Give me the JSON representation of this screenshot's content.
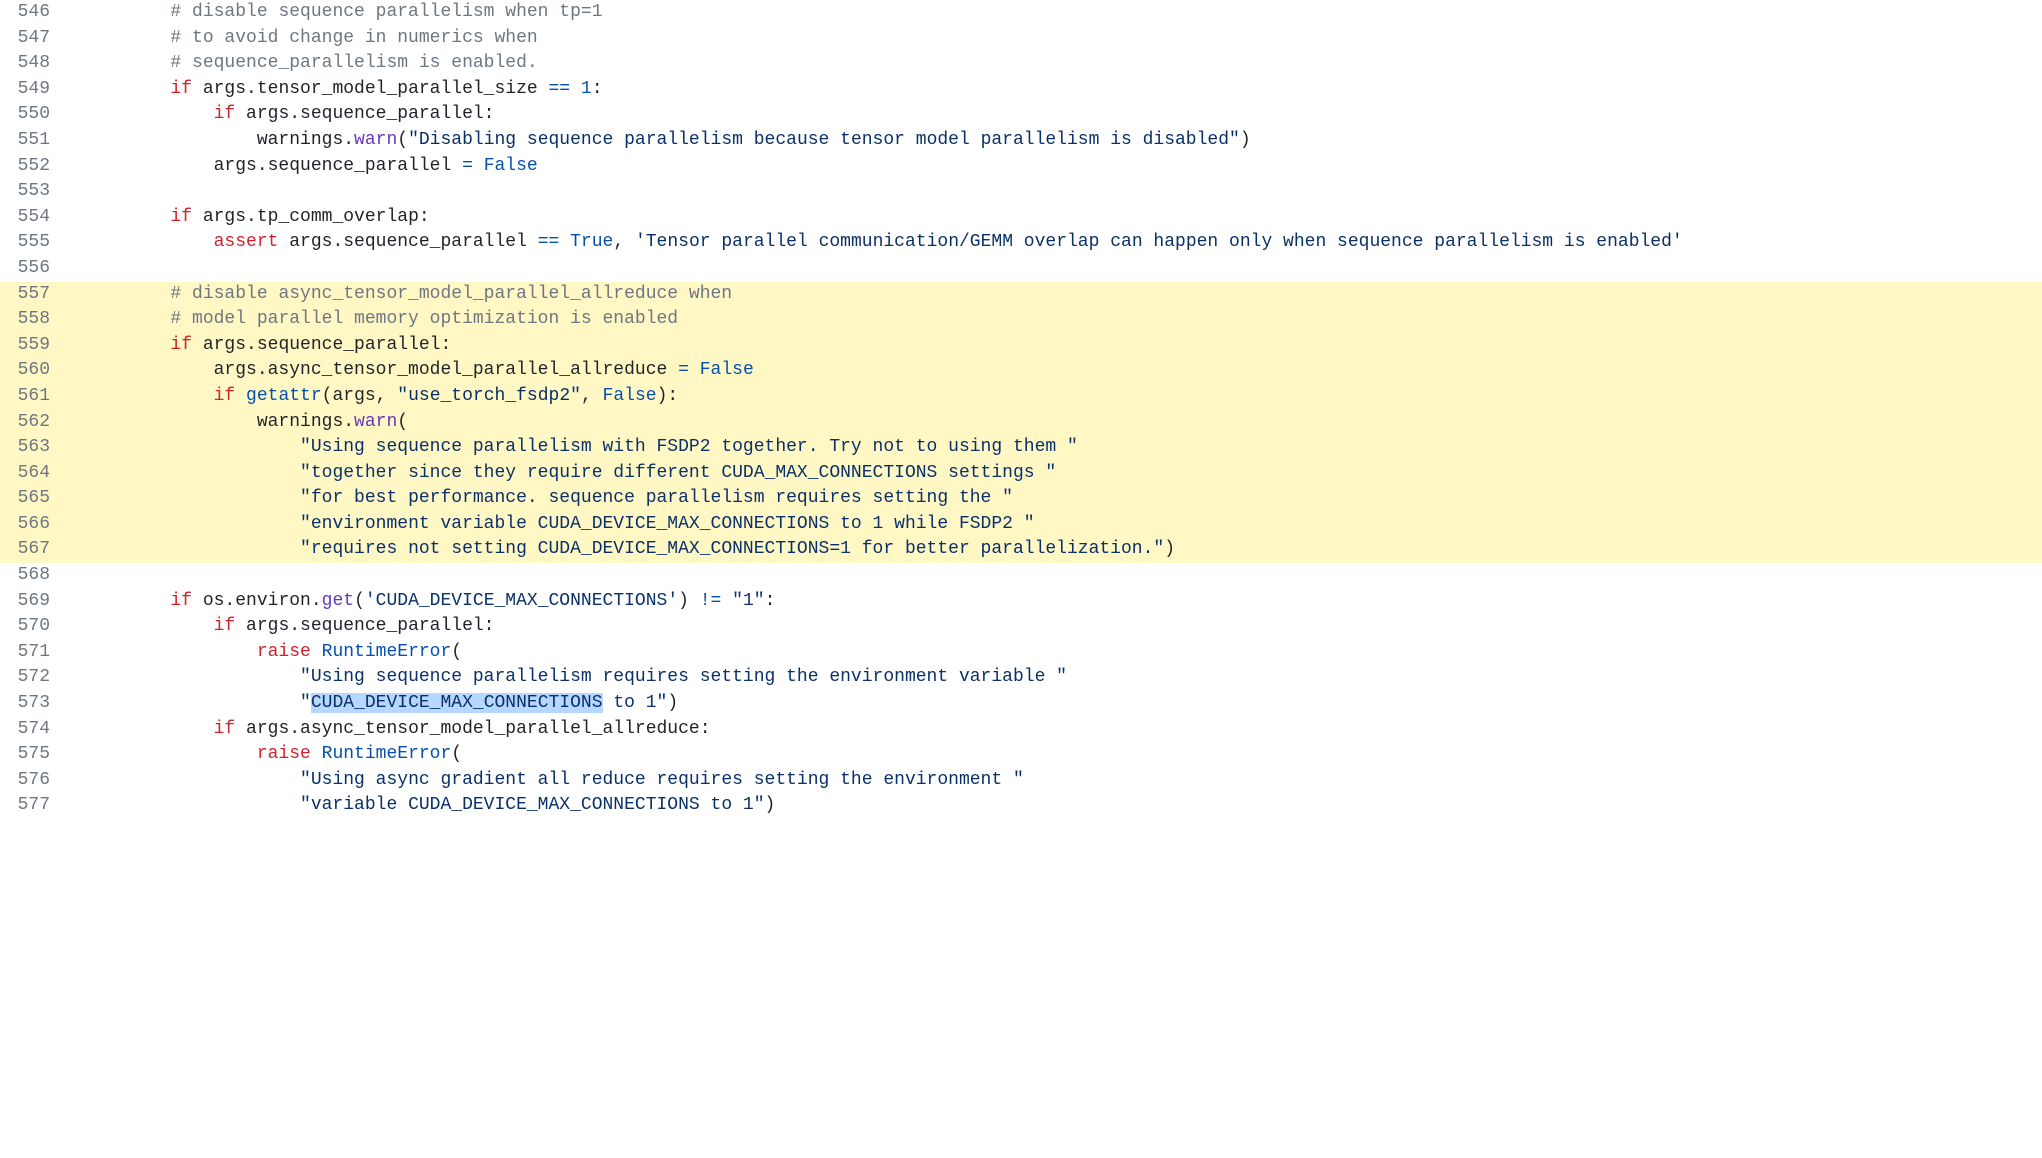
{
  "lines": [
    {
      "n": 546,
      "hl": false,
      "segs": [
        {
          "t": "        ",
          "c": ""
        },
        {
          "t": "# disable sequence parallelism when tp=1",
          "c": "c-comment"
        }
      ]
    },
    {
      "n": 547,
      "hl": false,
      "segs": [
        {
          "t": "        ",
          "c": ""
        },
        {
          "t": "# to avoid change in numerics when",
          "c": "c-comment"
        }
      ]
    },
    {
      "n": 548,
      "hl": false,
      "segs": [
        {
          "t": "        ",
          "c": ""
        },
        {
          "t": "# sequence_parallelism is enabled.",
          "c": "c-comment"
        }
      ]
    },
    {
      "n": 549,
      "hl": false,
      "segs": [
        {
          "t": "        ",
          "c": ""
        },
        {
          "t": "if",
          "c": "c-kw"
        },
        {
          "t": " args.tensor_model_parallel_size ",
          "c": ""
        },
        {
          "t": "==",
          "c": "c-op"
        },
        {
          "t": " ",
          "c": ""
        },
        {
          "t": "1",
          "c": "c-const"
        },
        {
          "t": ":",
          "c": ""
        }
      ]
    },
    {
      "n": 550,
      "hl": false,
      "segs": [
        {
          "t": "            ",
          "c": ""
        },
        {
          "t": "if",
          "c": "c-kw"
        },
        {
          "t": " args.sequence_parallel:",
          "c": ""
        }
      ]
    },
    {
      "n": 551,
      "hl": false,
      "segs": [
        {
          "t": "                warnings.",
          "c": ""
        },
        {
          "t": "warn",
          "c": "c-func"
        },
        {
          "t": "(",
          "c": ""
        },
        {
          "t": "\"Disabling sequence parallelism because tensor model parallelism is disabled\"",
          "c": "c-str"
        },
        {
          "t": ")",
          "c": ""
        }
      ]
    },
    {
      "n": 552,
      "hl": false,
      "segs": [
        {
          "t": "            args.sequence_parallel ",
          "c": ""
        },
        {
          "t": "=",
          "c": "c-op"
        },
        {
          "t": " ",
          "c": ""
        },
        {
          "t": "False",
          "c": "c-const"
        }
      ]
    },
    {
      "n": 553,
      "hl": false,
      "segs": [
        {
          "t": "",
          "c": ""
        }
      ]
    },
    {
      "n": 554,
      "hl": false,
      "segs": [
        {
          "t": "        ",
          "c": ""
        },
        {
          "t": "if",
          "c": "c-kw"
        },
        {
          "t": " args.tp_comm_overlap:",
          "c": ""
        }
      ]
    },
    {
      "n": 555,
      "hl": false,
      "segs": [
        {
          "t": "            ",
          "c": ""
        },
        {
          "t": "assert",
          "c": "c-kw"
        },
        {
          "t": " args.sequence_parallel ",
          "c": ""
        },
        {
          "t": "==",
          "c": "c-op"
        },
        {
          "t": " ",
          "c": ""
        },
        {
          "t": "True",
          "c": "c-const"
        },
        {
          "t": ", ",
          "c": ""
        },
        {
          "t": "'Tensor parallel communication/GEMM overlap can happen only when sequence parallelism is enabled'",
          "c": "c-str"
        }
      ]
    },
    {
      "n": 556,
      "hl": false,
      "segs": [
        {
          "t": "",
          "c": ""
        }
      ]
    },
    {
      "n": 557,
      "hl": true,
      "segs": [
        {
          "t": "        ",
          "c": ""
        },
        {
          "t": "# disable async_tensor_model_parallel_allreduce when",
          "c": "c-comment"
        }
      ]
    },
    {
      "n": 558,
      "hl": true,
      "segs": [
        {
          "t": "        ",
          "c": ""
        },
        {
          "t": "# model parallel memory optimization is enabled",
          "c": "c-comment"
        }
      ]
    },
    {
      "n": 559,
      "hl": true,
      "segs": [
        {
          "t": "        ",
          "c": ""
        },
        {
          "t": "if",
          "c": "c-kw"
        },
        {
          "t": " args.sequence_parallel:",
          "c": ""
        }
      ]
    },
    {
      "n": 560,
      "hl": true,
      "segs": [
        {
          "t": "            args.async_tensor_model_parallel_allreduce ",
          "c": ""
        },
        {
          "t": "=",
          "c": "c-op"
        },
        {
          "t": " ",
          "c": ""
        },
        {
          "t": "False",
          "c": "c-const"
        }
      ]
    },
    {
      "n": 561,
      "hl": true,
      "segs": [
        {
          "t": "            ",
          "c": ""
        },
        {
          "t": "if",
          "c": "c-kw"
        },
        {
          "t": " ",
          "c": ""
        },
        {
          "t": "getattr",
          "c": "c-builtin"
        },
        {
          "t": "(args, ",
          "c": ""
        },
        {
          "t": "\"use_torch_fsdp2\"",
          "c": "c-str"
        },
        {
          "t": ", ",
          "c": ""
        },
        {
          "t": "False",
          "c": "c-const"
        },
        {
          "t": "):",
          "c": ""
        }
      ]
    },
    {
      "n": 562,
      "hl": true,
      "segs": [
        {
          "t": "                warnings.",
          "c": ""
        },
        {
          "t": "warn",
          "c": "c-func"
        },
        {
          "t": "(",
          "c": ""
        }
      ]
    },
    {
      "n": 563,
      "hl": true,
      "segs": [
        {
          "t": "                    ",
          "c": ""
        },
        {
          "t": "\"Using sequence parallelism with FSDP2 together. Try not to using them \"",
          "c": "c-str"
        }
      ]
    },
    {
      "n": 564,
      "hl": true,
      "segs": [
        {
          "t": "                    ",
          "c": ""
        },
        {
          "t": "\"together since they require different CUDA_MAX_CONNECTIONS settings \"",
          "c": "c-str"
        }
      ]
    },
    {
      "n": 565,
      "hl": true,
      "segs": [
        {
          "t": "                    ",
          "c": ""
        },
        {
          "t": "\"for best performance. sequence parallelism requires setting the \"",
          "c": "c-str"
        }
      ]
    },
    {
      "n": 566,
      "hl": true,
      "segs": [
        {
          "t": "                    ",
          "c": ""
        },
        {
          "t": "\"environment variable CUDA_DEVICE_MAX_CONNECTIONS to 1 while FSDP2 \"",
          "c": "c-str"
        }
      ]
    },
    {
      "n": 567,
      "hl": true,
      "segs": [
        {
          "t": "                    ",
          "c": ""
        },
        {
          "t": "\"requires not setting CUDA_DEVICE_MAX_CONNECTIONS=1 for better parallelization.\"",
          "c": "c-str"
        },
        {
          "t": ")",
          "c": ""
        }
      ]
    },
    {
      "n": 568,
      "hl": false,
      "segs": [
        {
          "t": "",
          "c": ""
        }
      ]
    },
    {
      "n": 569,
      "hl": false,
      "segs": [
        {
          "t": "        ",
          "c": ""
        },
        {
          "t": "if",
          "c": "c-kw"
        },
        {
          "t": " os.environ.",
          "c": ""
        },
        {
          "t": "get",
          "c": "c-func"
        },
        {
          "t": "(",
          "c": ""
        },
        {
          "t": "'CUDA_DEVICE_MAX_CONNECTIONS'",
          "c": "c-str"
        },
        {
          "t": ") ",
          "c": ""
        },
        {
          "t": "!=",
          "c": "c-op"
        },
        {
          "t": " ",
          "c": ""
        },
        {
          "t": "\"1\"",
          "c": "c-str"
        },
        {
          "t": ":",
          "c": ""
        }
      ]
    },
    {
      "n": 570,
      "hl": false,
      "segs": [
        {
          "t": "            ",
          "c": ""
        },
        {
          "t": "if",
          "c": "c-kw"
        },
        {
          "t": " args.sequence_parallel:",
          "c": ""
        }
      ]
    },
    {
      "n": 571,
      "hl": false,
      "segs": [
        {
          "t": "                ",
          "c": ""
        },
        {
          "t": "raise",
          "c": "c-kw"
        },
        {
          "t": " ",
          "c": ""
        },
        {
          "t": "RuntimeError",
          "c": "c-builtin"
        },
        {
          "t": "(",
          "c": ""
        }
      ]
    },
    {
      "n": 572,
      "hl": false,
      "segs": [
        {
          "t": "                    ",
          "c": ""
        },
        {
          "t": "\"Using sequence parallelism requires setting the environment variable \"",
          "c": "c-str"
        }
      ]
    },
    {
      "n": 573,
      "hl": false,
      "segs": [
        {
          "t": "                    ",
          "c": ""
        },
        {
          "t": "\"",
          "c": "c-str"
        },
        {
          "t": "CUDA_DEVICE_MAX_CONNECTIONS",
          "c": "c-str sel"
        },
        {
          "t": " to 1\"",
          "c": "c-str"
        },
        {
          "t": ")",
          "c": ""
        }
      ]
    },
    {
      "n": 574,
      "hl": false,
      "segs": [
        {
          "t": "            ",
          "c": ""
        },
        {
          "t": "if",
          "c": "c-kw"
        },
        {
          "t": " args.async_tensor_model_parallel_allreduce:",
          "c": ""
        }
      ]
    },
    {
      "n": 575,
      "hl": false,
      "segs": [
        {
          "t": "                ",
          "c": ""
        },
        {
          "t": "raise",
          "c": "c-kw"
        },
        {
          "t": " ",
          "c": ""
        },
        {
          "t": "RuntimeError",
          "c": "c-builtin"
        },
        {
          "t": "(",
          "c": ""
        }
      ]
    },
    {
      "n": 576,
      "hl": false,
      "segs": [
        {
          "t": "                    ",
          "c": ""
        },
        {
          "t": "\"Using async gradient all reduce requires setting the environment \"",
          "c": "c-str"
        }
      ]
    },
    {
      "n": 577,
      "hl": false,
      "segs": [
        {
          "t": "                    ",
          "c": ""
        },
        {
          "t": "\"variable CUDA_DEVICE_MAX_CONNECTIONS to 1\"",
          "c": "c-str"
        },
        {
          "t": ")",
          "c": ""
        }
      ]
    }
  ]
}
